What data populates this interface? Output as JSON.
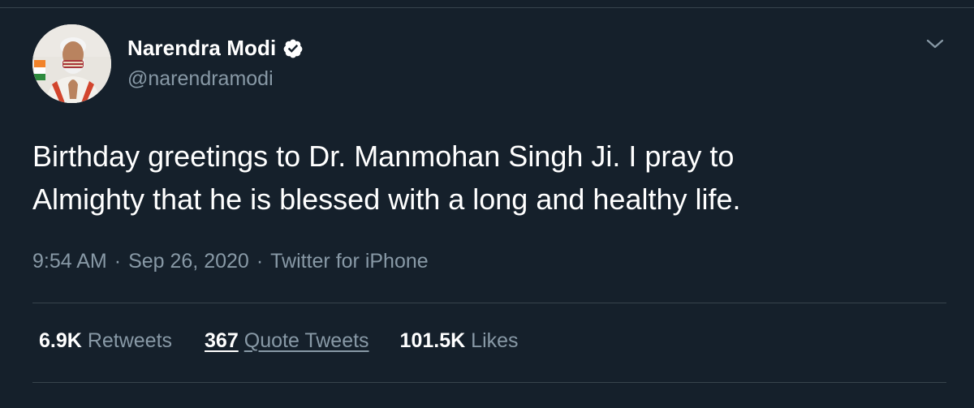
{
  "author": {
    "name": "Narendra Modi",
    "handle": "@narendramodi",
    "verified": true,
    "avatar_icon": "profile-photo-icon"
  },
  "tweet": {
    "lines": [
      "Birthday greetings to Dr. Manmohan Singh Ji. I pray to",
      "Almighty that he is blessed with a long and healthy life."
    ]
  },
  "meta": {
    "time": "9:54 AM",
    "date": "Sep 26, 2020",
    "separator": "·",
    "source": "Twitter for iPhone"
  },
  "stats": {
    "retweets": {
      "count": "6.9K",
      "label": "Retweets"
    },
    "quote_tweets": {
      "count": "367",
      "label": "Quote Tweets"
    },
    "likes": {
      "count": "101.5K",
      "label": "Likes"
    }
  },
  "icons": {
    "verified": "verified-badge-icon",
    "more": "chevron-down-icon"
  },
  "colors": {
    "background": "#15202b",
    "text": "#ffffff",
    "secondary_text": "#8899a6",
    "divider": "#38444d"
  }
}
